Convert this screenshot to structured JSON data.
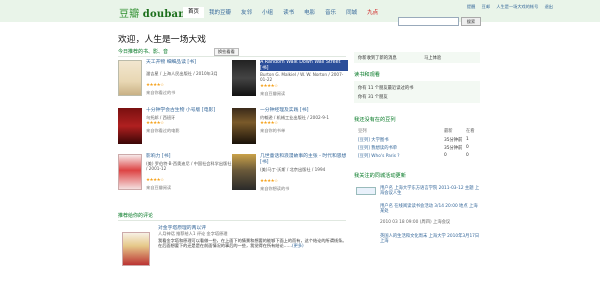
{
  "topbar": {
    "logo_cn": "豆瓣",
    "logo_en": "douban",
    "nav": [
      "首页",
      "我的豆瓣",
      "友邻",
      "小组",
      "读书",
      "电影",
      "音乐",
      "同城",
      "九点"
    ],
    "user_links": [
      "提醒",
      "豆邮",
      "人生是一场大戏的帐号",
      "退出"
    ],
    "search_button": "搜索"
  },
  "main": {
    "greeting": "欢迎，人生是一场大戏",
    "today_title": "今日推荐的书、影、音",
    "more_button": "换些看看",
    "reviews_title": "推荐给你的评论"
  },
  "recommendations": [
    {
      "title": "天工开物 细细品读 [书]",
      "meta": "潘吉星 / 上海人民出版社 / 2010年3月",
      "stars": "★★★★☆",
      "reason": "来自你看过的书"
    },
    {
      "title": "A Random Walk Down Wall Street [书]",
      "meta": "Burton G. Malkiel / W. W. Norton / 2007-01-22",
      "stars": "★★★★☆",
      "reason": "来自豆瓣阅读"
    },
    {
      "title": "十分钟学会古生物 小号版 [电影]",
      "meta": "乌托邦 / 西班牙",
      "stars": "★★★★☆",
      "reason": "来自你看过的电影"
    },
    {
      "title": "一分钟经理及实践 [书]",
      "meta": "约翰逊 / 机械工业出版社 / 2002-9-1",
      "stars": "★★★★☆",
      "reason": "来自你的书单"
    },
    {
      "title": "影响力 [书]",
      "meta": "(美) 罗伯特·B·西奥迪尼 / 中国社会科学出版社 / 2001-12",
      "stars": "★★★★☆",
      "reason": "来自豆瓣阅读"
    },
    {
      "title": "几世童话和浪漫故事的主张 - 时代和思想 [书]",
      "meta": "(美)马丁·沃斯 / 北京出版社 / 1994",
      "stars": "★★★★☆",
      "reason": "来自你想读的书"
    }
  ],
  "review": {
    "title": "对金字塔原理的两以评",
    "by": "人月神话 推荐给人1 评论 金字塔原理",
    "body": "我看金字塔和原理可以看做一些，在上面下的情景和想要的能够下面上的而有，这个结论的所谓线条。在后面想要下的还是是在前面情况的事后的一些，我觉得在所有结论……",
    "more": "(更多)"
  },
  "sidebar": {
    "notice_line": "你新收到了新的消息",
    "notice_link": "马上体验",
    "reads_head": "读书和观看",
    "reads": [
      "你有 11 个朋友最近读过的书",
      "你有 31 个朋友"
    ],
    "doulists_head": "我还没有在的豆列",
    "doulist_cols": [
      "豆列",
      "最新",
      "在看"
    ],
    "doulists": [
      {
        "name": "[豆列] 大学图书",
        "c2": "35分钟前",
        "c3": "1"
      },
      {
        "name": "[豆列] 我想读的书单",
        "c2": "35分钟前",
        "c3": "0"
      },
      {
        "name": "[豆列] Who's Paris ?",
        "c2": "0",
        "c3": "0"
      }
    ],
    "updates_head": "我关注的同城活动更新",
    "updates": [
      "用户名 上海大学东方语言学院 2011-03-12 主题 上海会议人生",
      "用户名 在线阅读读书会活动 3/14 20:00 地点 上海某处",
      "2010 03 18 09:00 (周四) 上海会议",
      "英国人的生活和文化周末 上海大学 2010年3月17日 上海"
    ]
  }
}
